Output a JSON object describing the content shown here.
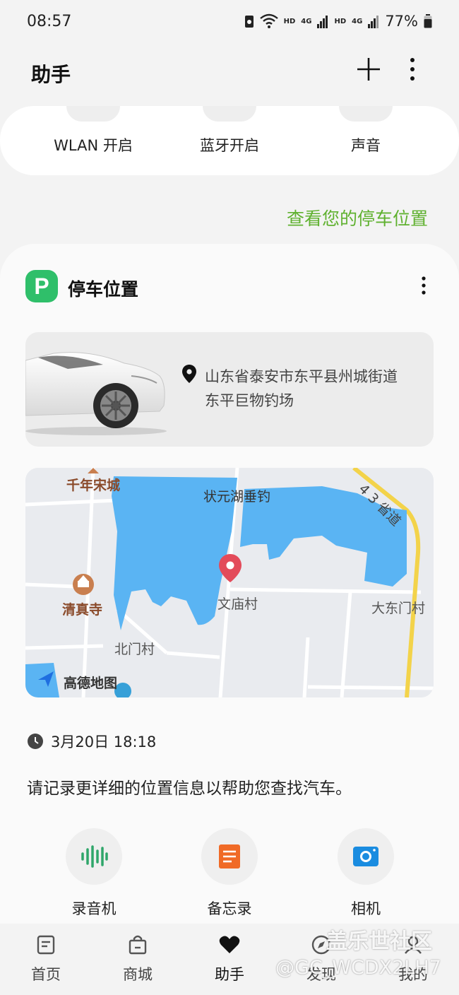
{
  "status_bar": {
    "time": "08:57",
    "hd1": "HD",
    "net1": "4G",
    "hd2": "HD",
    "net2": "4G",
    "battery": "77%"
  },
  "header": {
    "title": "助手"
  },
  "quick_settings": {
    "items": [
      {
        "label": "WLAN 开启"
      },
      {
        "label": "蓝牙开启"
      },
      {
        "label": "声音"
      }
    ]
  },
  "parking_link": "查看您的停车位置",
  "parking_card": {
    "icon_letter": "P",
    "title": "停车位置",
    "address_line1": "山东省泰安市东平县州城街道",
    "address_line2": "东平巨物钓场",
    "map": {
      "labels": {
        "qiannian": "千年宋城",
        "zhuangyuan": "状元湖垂钓",
        "road43": "4 3 省道",
        "qingzhensi": "清真寺",
        "wenmiao": "文庙村",
        "dadongmen": "大东门村",
        "beimen": "北门村",
        "brand": "高德地图"
      }
    },
    "date_time": "3月20日 18:18",
    "hint": "请记录更详细的位置信息以帮助您查找汽车。",
    "tools": [
      {
        "label": "录音机",
        "icon": "waveform-icon"
      },
      {
        "label": "备忘录",
        "icon": "memo-icon"
      },
      {
        "label": "相机",
        "icon": "camera-icon"
      }
    ]
  },
  "bottom_nav": {
    "items": [
      {
        "label": "首页",
        "icon": "home-icon"
      },
      {
        "label": "商城",
        "icon": "shopping-bag-icon"
      },
      {
        "label": "助手",
        "icon": "heart-icon"
      },
      {
        "label": "发现",
        "icon": "compass-icon"
      },
      {
        "label": "我的",
        "icon": "person-icon"
      }
    ]
  },
  "watermark": {
    "line1": "盖乐世社区",
    "line2": "@GC_WCDX2LH7"
  },
  "colors": {
    "accent_green": "#5fb12f",
    "parking_icon": "#2fbf6a",
    "map_water": "#5ab4f3",
    "pin_red": "#e34b5a"
  }
}
